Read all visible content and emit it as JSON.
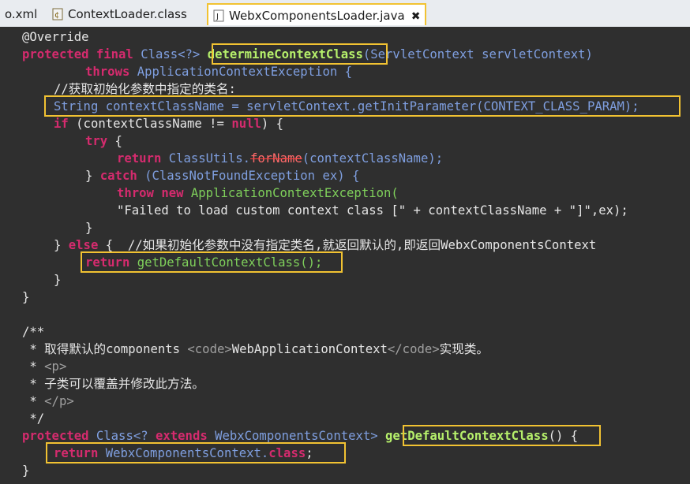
{
  "tabs": [
    {
      "label": "o.xml"
    },
    {
      "label": "ContextLoader.class"
    },
    {
      "label": "WebxComponentsLoader.java"
    }
  ],
  "close_glyph": "✖",
  "code": {
    "l1": "@Override",
    "l2_kw": "protected final",
    "l2_type": " Class<?> ",
    "l2_fn": "determineContextClass",
    "l2_rest": "(ServletContext servletContext)",
    "l3_kw": "throws",
    "l3_rest": " ApplicationContextException {",
    "l4": "//获取初始化参数中指定的类名:",
    "l5": "String contextClassName = servletContext.getInitParameter(CONTEXT_CLASS_PARAM);",
    "l6_kw": "if",
    "l6_rest": " (contextClassName != ",
    "l6_null": "null",
    "l6_end": ") {",
    "l7_kw": "try",
    "l7_rest": " {",
    "l8_kw": "return",
    "l8_a": " ClassUtils.",
    "l8_strike": "forName",
    "l8_b": "(contextClassName);",
    "l9_a": "} ",
    "l9_kw": "catch",
    "l9_rest": " (ClassNotFoundException ex) {",
    "l10_kw": "throw new",
    "l10_rest": " ApplicationContextException(",
    "l11": "\"Failed to load custom context class [\" + contextClassName + \"]\",ex);",
    "l12": "}",
    "l13_a": "} ",
    "l13_kw": "else",
    "l13_rest": " {  //如果初始化参数中没有指定类名,就返回默认的,即返回WebxComponentsContext",
    "l14_kw": "return",
    "l14_rest": " getDefaultContextClass();",
    "l15": "}",
    "l16": "}",
    "l18": "/**",
    "l19_a": " * 取得默认的components ",
    "l19_tag1": "<code>",
    "l19_b": "WebApplicationContext",
    "l19_tag2": "</code>",
    "l19_c": "实现类。",
    "l20_a": " * ",
    "l20_tag": "<p>",
    "l21": " * 子类可以覆盖并修改此方法。",
    "l22_a": " * ",
    "l22_tag": "</p>",
    "l23": " */",
    "l24_kw": "protected",
    "l24_type": " Class<? ",
    "l24_kw2": "extends",
    "l24_rest": " WebxComponentsContext> ",
    "l24_fn": "getDefaultContextClass",
    "l24_end": "() {",
    "l25_kw": "return",
    "l25_rest": " WebxComponentsContext.",
    "l25_kw2": "class",
    "l25_end": ";",
    "l26": "}"
  }
}
